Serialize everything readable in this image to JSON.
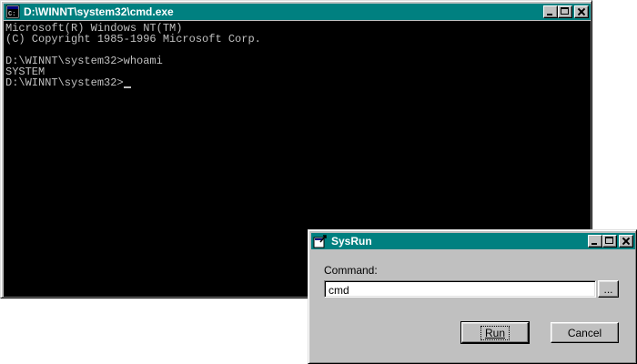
{
  "cmd_window": {
    "title": "D:\\WINNT\\system32\\cmd.exe",
    "console_lines": [
      "Microsoft(R) Windows NT(TM)",
      "(C) Copyright 1985-1996 Microsoft Corp.",
      "",
      "D:\\WINNT\\system32>whoami",
      "SYSTEM"
    ],
    "prompt": "D:\\WINNT\\system32>",
    "colors": {
      "titlebar": "#008080",
      "console_bg": "#000000",
      "console_text": "#c0c0c0"
    }
  },
  "sysrun_dialog": {
    "title": "SysRun",
    "command_label": "Command:",
    "command_value": "cmd",
    "browse_label": "...",
    "run_label": "Run",
    "cancel_label": "Cancel",
    "colors": {
      "titlebar": "#008080",
      "face": "#c0c0c0"
    }
  },
  "icons": {
    "cmd_window_icon": "command-prompt-icon",
    "sysrun_icon": "run-icon",
    "minimize": "minimize-icon",
    "maximize": "maximize-icon",
    "close": "close-icon"
  }
}
